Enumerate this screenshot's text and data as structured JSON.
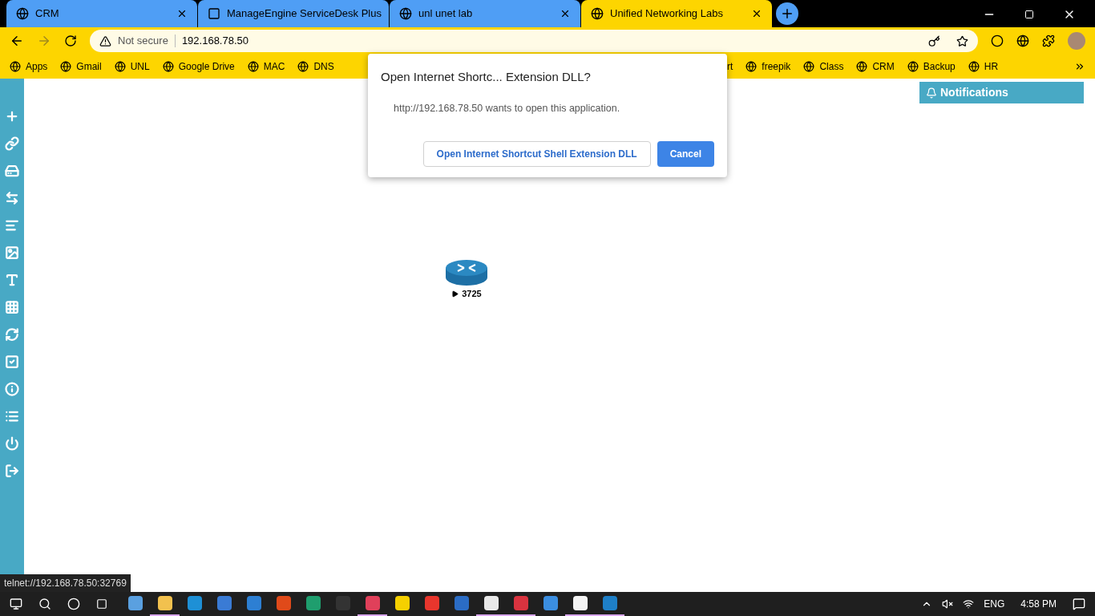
{
  "tabs": [
    {
      "title": "CRM",
      "selected": false
    },
    {
      "title": "ManageEngine ServiceDesk Plus",
      "selected": false
    },
    {
      "title": "unl unet lab",
      "selected": false
    },
    {
      "title": "Unified Networking Labs",
      "selected": true
    }
  ],
  "address_bar": {
    "security": "Not secure",
    "url": "192.168.78.50"
  },
  "bookmarks": [
    "Apps",
    "Gmail",
    "UNL",
    "Google Drive",
    "MAC",
    "DNS"
  ],
  "bookmarks_right": [
    "rt",
    "freepik",
    "Class",
    "CRM",
    "Backup",
    "HR"
  ],
  "notifications": {
    "title": "Notifications"
  },
  "dialog": {
    "title": "Open Internet Shortc... Extension DLL?",
    "message": "http://192.168.78.50 wants to open this application.",
    "buttons": [
      {
        "label": "Open Internet Shortcut Shell Extension DLL",
        "kind": "secondary"
      },
      {
        "label": "Cancel",
        "kind": "primary"
      }
    ]
  },
  "node": {
    "label": "3725"
  },
  "status_link": "telnet://192.168.78.50:32769",
  "taskbar": {
    "apps": [
      {
        "running": false
      },
      {
        "running": true
      },
      {
        "running": false
      },
      {
        "running": false
      },
      {
        "running": false
      },
      {
        "running": false
      },
      {
        "running": false
      },
      {
        "running": false
      },
      {
        "running": true
      },
      {
        "running": false
      },
      {
        "running": false
      },
      {
        "running": false
      },
      {
        "running": true
      },
      {
        "running": true
      },
      {
        "running": false
      },
      {
        "running": true
      },
      {
        "running": true
      }
    ],
    "language": "ENG",
    "time": "4:58 PM"
  }
}
